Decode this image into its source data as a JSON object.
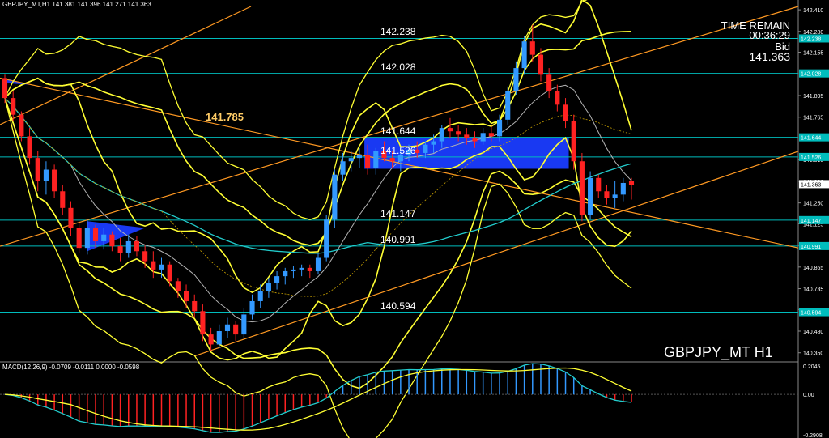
{
  "header": {
    "symbol_timeframe": "GBPJPY_MT,H1",
    "ohlc": "141.381 141.396 141.271 141.363"
  },
  "info_panel": {
    "time_remain_label": "TIME REMAIN",
    "time_remain": "00:36:29",
    "bid_label": "Bid",
    "bid": "141.363"
  },
  "watermark": "GBPJPY_MT H1",
  "highlight_level": "141.785",
  "macd": {
    "label": "MACD(12,26,9) -0.0709 -0.0111 0.0000 -0.0598",
    "axis_labels": [
      "0.2045",
      "0.00",
      "-0.2908"
    ]
  },
  "chart_data": {
    "type": "candlestick",
    "price_axis": {
      "range": [
        140.3,
        142.43
      ],
      "ticks": [
        "142.410",
        "142.280",
        "142.155",
        "142.025",
        "141.895",
        "141.765",
        "141.640",
        "141.510",
        "141.380",
        "141.250",
        "141.125",
        "140.995",
        "140.865",
        "140.735",
        "140.610",
        "140.480",
        "140.350"
      ]
    },
    "horizontal_levels": [
      {
        "label": "142.238",
        "value": 142.238,
        "tag": "142.238"
      },
      {
        "label": "142.028",
        "value": 142.028,
        "tag": "142.028"
      },
      {
        "label": "141.644",
        "value": 141.644,
        "tag": "141.644"
      },
      {
        "label": "141.526",
        "value": 141.526,
        "tag": "141.526"
      },
      {
        "label": "141.147",
        "value": 141.147,
        "tag": "141.147"
      },
      {
        "label": "140.991",
        "value": 140.991,
        "tag": "140.991"
      },
      {
        "label": "140.594",
        "value": 140.594,
        "tag": "140.594"
      }
    ],
    "current_price_tag": "141.363",
    "candles": [
      [
        142.0,
        142.02,
        141.85,
        141.88
      ],
      [
        141.88,
        141.92,
        141.74,
        141.78
      ],
      [
        141.78,
        141.8,
        141.62,
        141.65
      ],
      [
        141.65,
        141.7,
        141.48,
        141.52
      ],
      [
        141.52,
        141.56,
        141.32,
        141.38
      ],
      [
        141.38,
        141.5,
        141.3,
        141.45
      ],
      [
        141.45,
        141.48,
        141.28,
        141.32
      ],
      [
        141.32,
        141.36,
        141.18,
        141.22
      ],
      [
        141.22,
        141.26,
        141.05,
        141.1
      ],
      [
        141.1,
        141.14,
        140.95,
        140.98
      ],
      [
        140.98,
        141.15,
        140.94,
        141.1
      ],
      [
        141.1,
        141.12,
        140.98,
        141.02
      ],
      [
        141.02,
        141.1,
        140.97,
        141.06
      ],
      [
        141.06,
        141.08,
        140.96,
        140.99
      ],
      [
        140.99,
        141.04,
        140.9,
        140.95
      ],
      [
        140.95,
        141.06,
        140.92,
        141.02
      ],
      [
        141.02,
        141.05,
        140.93,
        140.96
      ],
      [
        140.96,
        141.0,
        140.86,
        140.9
      ],
      [
        140.9,
        140.96,
        140.8,
        140.85
      ],
      [
        140.85,
        140.92,
        140.8,
        140.88
      ],
      [
        140.88,
        140.9,
        140.75,
        140.78
      ],
      [
        140.78,
        140.8,
        140.68,
        140.72
      ],
      [
        140.72,
        140.76,
        140.62,
        140.66
      ],
      [
        140.66,
        140.7,
        140.56,
        140.6
      ],
      [
        140.6,
        140.64,
        140.42,
        140.46
      ],
      [
        140.46,
        140.5,
        140.36,
        140.4
      ],
      [
        140.4,
        140.52,
        140.38,
        140.48
      ],
      [
        140.48,
        140.56,
        140.44,
        140.52
      ],
      [
        140.52,
        140.54,
        140.42,
        140.46
      ],
      [
        140.46,
        140.62,
        140.44,
        140.58
      ],
      [
        140.58,
        140.7,
        140.55,
        140.66
      ],
      [
        140.66,
        140.76,
        140.62,
        140.72
      ],
      [
        140.72,
        140.8,
        140.68,
        140.77
      ],
      [
        140.77,
        140.84,
        140.73,
        140.81
      ],
      [
        140.81,
        140.86,
        140.76,
        140.84
      ],
      [
        140.84,
        140.87,
        140.8,
        140.85
      ],
      [
        140.85,
        140.88,
        140.81,
        140.86
      ],
      [
        140.86,
        140.88,
        140.8,
        140.84
      ],
      [
        140.84,
        140.95,
        140.82,
        140.92
      ],
      [
        140.92,
        141.18,
        140.9,
        141.15
      ],
      [
        141.15,
        141.45,
        141.1,
        141.42
      ],
      [
        141.42,
        141.55,
        141.38,
        141.5
      ],
      [
        141.5,
        141.56,
        141.44,
        141.52
      ],
      [
        141.52,
        141.58,
        141.46,
        141.54
      ],
      [
        141.54,
        141.6,
        141.42,
        141.46
      ],
      [
        141.46,
        141.58,
        141.42,
        141.56
      ],
      [
        141.56,
        141.62,
        141.5,
        141.52
      ],
      [
        141.52,
        141.56,
        141.46,
        141.5
      ],
      [
        141.5,
        141.56,
        141.44,
        141.54
      ],
      [
        141.54,
        141.6,
        141.5,
        141.57
      ],
      [
        141.57,
        141.62,
        141.52,
        141.55
      ],
      [
        141.55,
        141.62,
        141.52,
        141.6
      ],
      [
        141.6,
        141.66,
        141.55,
        141.62
      ],
      [
        141.62,
        141.72,
        141.58,
        141.7
      ],
      [
        141.7,
        141.76,
        141.64,
        141.68
      ],
      [
        141.68,
        141.72,
        141.62,
        141.66
      ],
      [
        141.66,
        141.7,
        141.6,
        141.64
      ],
      [
        141.64,
        141.68,
        141.58,
        141.62
      ],
      [
        141.62,
        141.7,
        141.6,
        141.67
      ],
      [
        141.67,
        141.72,
        141.62,
        141.65
      ],
      [
        141.65,
        141.78,
        141.62,
        141.75
      ],
      [
        141.75,
        141.95,
        141.72,
        141.92
      ],
      [
        141.92,
        142.1,
        141.9,
        142.06
      ],
      [
        142.06,
        142.25,
        142.02,
        142.22
      ],
      [
        142.22,
        142.32,
        142.1,
        142.14
      ],
      [
        142.14,
        142.18,
        141.98,
        142.02
      ],
      [
        142.02,
        142.06,
        141.88,
        141.92
      ],
      [
        141.92,
        141.96,
        141.8,
        141.84
      ],
      [
        141.84,
        141.88,
        141.7,
        141.74
      ],
      [
        141.74,
        141.78,
        141.45,
        141.5
      ],
      [
        141.5,
        141.55,
        141.14,
        141.18
      ],
      [
        141.18,
        141.44,
        141.15,
        141.4
      ],
      [
        141.4,
        141.42,
        141.28,
        141.32
      ],
      [
        141.32,
        141.36,
        141.24,
        141.28
      ],
      [
        141.28,
        141.38,
        141.22,
        141.3
      ],
      [
        141.3,
        141.4,
        141.26,
        141.37
      ],
      [
        141.38,
        141.4,
        141.27,
        141.36
      ]
    ]
  },
  "colors": {
    "bull": "#3399ff",
    "bear": "#ff2222",
    "level_line": "#00bcbc",
    "band": "#ffff33",
    "ma": "#b3b3b3",
    "slow_ma": "#22cccc",
    "trend": "#ff9922",
    "zone": "#1a3cff"
  }
}
